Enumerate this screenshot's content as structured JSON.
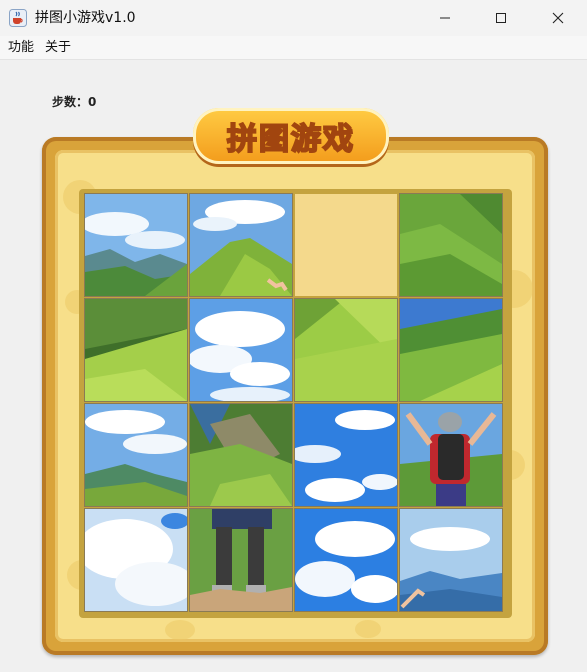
{
  "window": {
    "title": "拼图小游戏v1.0",
    "icon": "java-cup-icon",
    "controls": [
      "minimize-icon",
      "maximize-icon",
      "close-icon"
    ]
  },
  "menu": {
    "items": [
      {
        "label": "功能"
      },
      {
        "label": "关于"
      }
    ]
  },
  "game": {
    "steps_label": "步数：0",
    "banner": "拼图游戏",
    "grid_size": 4,
    "empty_tile": 3,
    "tiles": [
      {
        "scene": "mountain-sky-left"
      },
      {
        "scene": "mountain-peak-hand"
      },
      {
        "scene": "empty"
      },
      {
        "scene": "grass-slope-right"
      },
      {
        "scene": "grass-slope-dark"
      },
      {
        "scene": "clouds-blue"
      },
      {
        "scene": "grass-field"
      },
      {
        "scene": "mountain-ridge-right"
      },
      {
        "scene": "clouds-mountain-low"
      },
      {
        "scene": "rocky-cliff-green"
      },
      {
        "scene": "sky-clouds-lower"
      },
      {
        "scene": "hiker-backpack-top"
      },
      {
        "scene": "clouds-white"
      },
      {
        "scene": "hiker-legs-rock"
      },
      {
        "scene": "clouds-sky-right"
      },
      {
        "scene": "blue-mountains-hand"
      }
    ]
  },
  "colors": {
    "frame": "#d9a33a",
    "board": "#f7df8a",
    "banner": "#f5a623"
  }
}
